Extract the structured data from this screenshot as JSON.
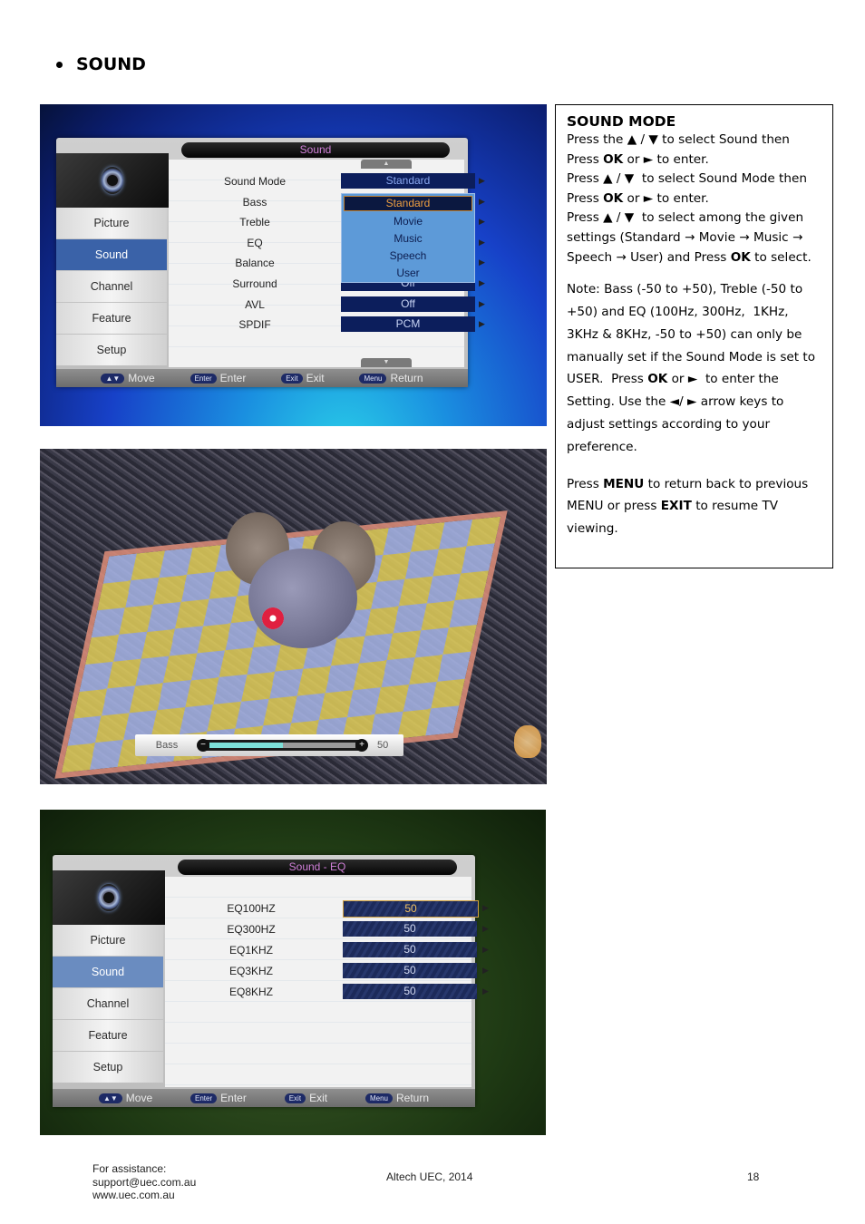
{
  "heading": "SOUND",
  "osd_sound": {
    "title": "Sound",
    "sidebar": [
      "Picture",
      "Sound",
      "Channel",
      "Feature",
      "Setup"
    ],
    "active_sidebar": "Sound",
    "rows": [
      {
        "label": "Sound Mode",
        "value": "Standard"
      },
      {
        "label": "Bass",
        "value": ""
      },
      {
        "label": "Treble",
        "value": ""
      },
      {
        "label": "EQ",
        "value": ""
      },
      {
        "label": "Balance",
        "value": ""
      },
      {
        "label": "Surround",
        "value": "Off"
      },
      {
        "label": "AVL",
        "value": "Off"
      },
      {
        "label": "SPDIF",
        "value": "PCM"
      }
    ],
    "dropdown_options": [
      "Standard",
      "Movie",
      "Music",
      "Speech",
      "User"
    ],
    "dropdown_selected": "Standard",
    "footer_hints": [
      {
        "key": "▲▼",
        "label": "Move"
      },
      {
        "key": "Enter",
        "label": "Enter"
      },
      {
        "key": "Exit",
        "label": "Exit"
      },
      {
        "key": "Menu",
        "label": "Return"
      }
    ]
  },
  "bass_overlay": {
    "label": "Bass",
    "value": "50",
    "minus": "−",
    "plus": "+",
    "fill_fraction": 0.5
  },
  "osd_eq": {
    "title": "Sound - EQ",
    "sidebar": [
      "Picture",
      "Sound",
      "Channel",
      "Feature",
      "Setup"
    ],
    "active_sidebar": "Sound",
    "rows": [
      {
        "label": "EQ100HZ",
        "value": "50"
      },
      {
        "label": "EQ300HZ",
        "value": "50"
      },
      {
        "label": "EQ1KHZ",
        "value": "50"
      },
      {
        "label": "EQ3KHZ",
        "value": "50"
      },
      {
        "label": "EQ8KHZ",
        "value": "50"
      }
    ],
    "footer_hints": [
      {
        "key": "▲▼",
        "label": "Move"
      },
      {
        "key": "Enter",
        "label": "Enter"
      },
      {
        "key": "Exit",
        "label": "Exit"
      },
      {
        "key": "Menu",
        "label": "Return"
      }
    ]
  },
  "info_box": {
    "title": "SOUND MODE",
    "para1_html": "Press the ▲ / ▼ to select Sound then Press <b>OK</b> or ► to enter.<br>Press ▲ / ▼ &nbsp;to select Sound Mode then Press <b>OK</b> or ► to enter.<br>Press ▲ / ▼ &nbsp;to select among the given settings (Standard → Movie → Music → Speech → User) and Press <b>OK</b> to select.",
    "note_html": "Note: Bass (-50 to +50), Treble (-50 to +50) and EQ (100Hz, 300Hz, &nbsp;1KHz, 3KHz &amp; 8KHz, -50 to +50) can only be manually set if the Sound Mode is set to USER. &nbsp;Press <b>OK</b> or ► &nbsp;to enter the Setting. Use the ◄/ ► arrow keys to adjust settings according to your preference.",
    "menu_html": "Press <b>MENU</b> to return back to previous MENU or press <b>EXIT</b> to resume TV viewing."
  },
  "footer": {
    "assist_line1": "For assistance:",
    "assist_line2": "support@uec.com.au",
    "assist_line3": "www.uec.com.au",
    "center": "Altech UEC, 2014",
    "page_number": "18"
  }
}
